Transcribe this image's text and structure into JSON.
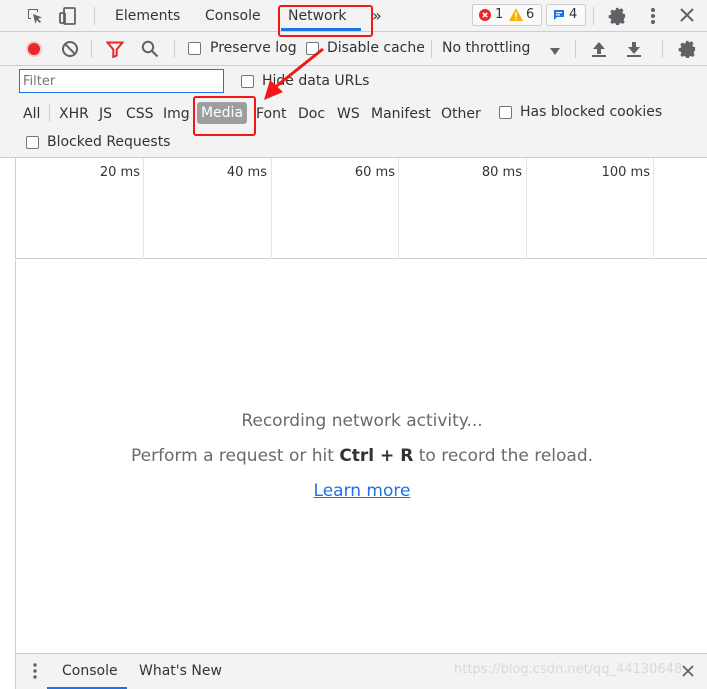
{
  "tabbar": {
    "tabs": [
      {
        "label": "Elements"
      },
      {
        "label": "Console"
      },
      {
        "label": "Network"
      }
    ],
    "more": "»",
    "errors": "1",
    "warnings": "6",
    "messages": "4"
  },
  "toolbar": {
    "preserve_log": "Preserve log",
    "disable_cache": "Disable cache",
    "throttling": "No throttling"
  },
  "filter": {
    "placeholder": "Filter",
    "hide_data_urls": "Hide data URLs",
    "types": [
      "All",
      "XHR",
      "JS",
      "CSS",
      "Img",
      "Media",
      "Font",
      "Doc",
      "WS",
      "Manifest",
      "Other"
    ],
    "has_blocked_cookies": "Has blocked cookies",
    "blocked_requests": "Blocked Requests"
  },
  "timeline": {
    "ticks": [
      "20 ms",
      "40 ms",
      "60 ms",
      "80 ms",
      "100 ms"
    ]
  },
  "empty": {
    "recording": "Recording network activity...",
    "perform_pre": "Perform a request or hit ",
    "shortcut_ctrl": "Ctrl",
    "shortcut_plus": " + ",
    "shortcut_r": "R",
    "perform_post": " to record the reload.",
    "learn_more": "Learn more"
  },
  "drawer": {
    "tabs": [
      {
        "label": "Console"
      },
      {
        "label": "What's New"
      }
    ]
  },
  "watermark": "https://blog.csdn.net/qq_44130648",
  "colors": {
    "accent": "#1a73e8",
    "highlight": "#f21818",
    "record": "#e8272b"
  }
}
